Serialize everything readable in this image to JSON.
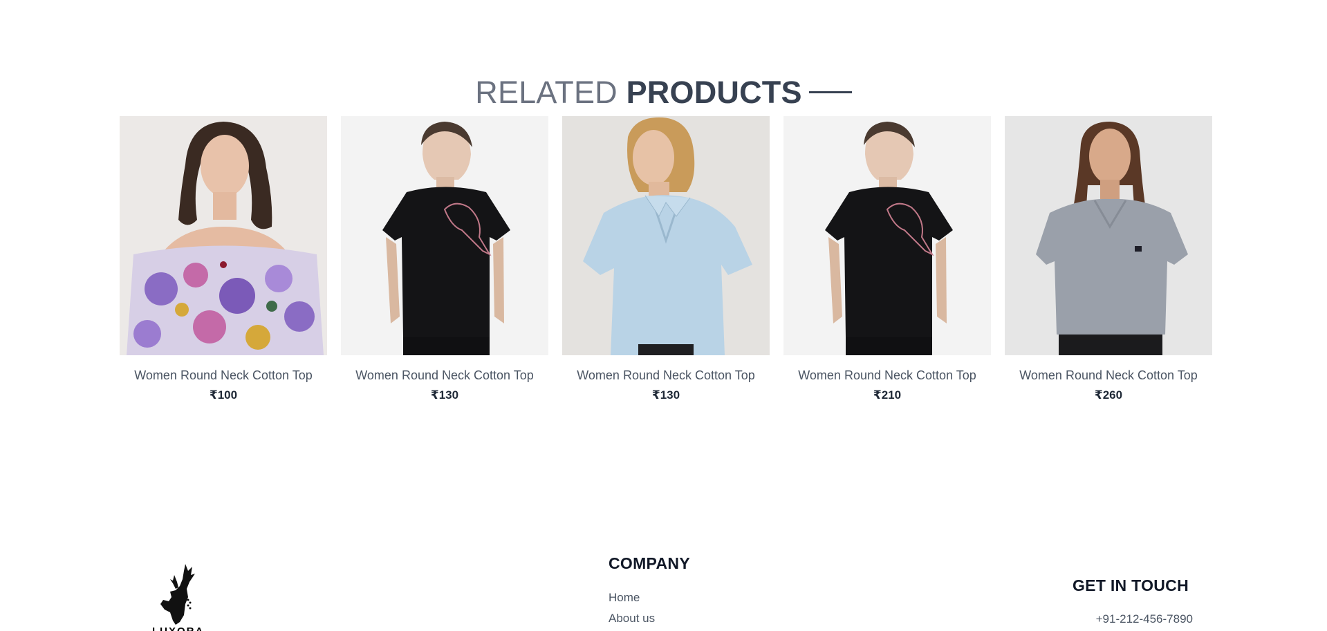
{
  "related": {
    "title_light": "RELATED",
    "title_bold": "PRODUCTS",
    "products": [
      {
        "name": "Women Round Neck Cotton Top",
        "price": "₹100"
      },
      {
        "name": "Women Round Neck Cotton Top",
        "price": "₹130"
      },
      {
        "name": "Women Round Neck Cotton Top",
        "price": "₹130"
      },
      {
        "name": "Women Round Neck Cotton Top",
        "price": "₹210"
      },
      {
        "name": "Women Round Neck Cotton Top",
        "price": "₹260"
      }
    ]
  },
  "footer": {
    "logo_text": "LUXORA",
    "company": {
      "heading": "COMPANY",
      "links": [
        "Home",
        "About us"
      ]
    },
    "contact": {
      "heading": "GET IN TOUCH",
      "phone": "+91-212-456-7890"
    }
  },
  "colors": {
    "text_dark": "#374151",
    "text_muted": "#6b7280"
  }
}
